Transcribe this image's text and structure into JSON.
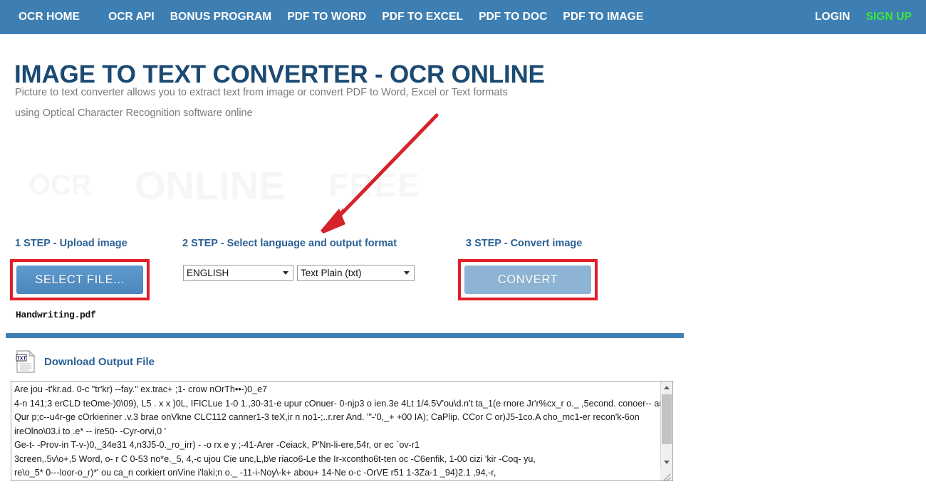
{
  "navbar": {
    "left_items": [
      {
        "label": "OCR HOME",
        "name": "nav-ocr-home"
      },
      {
        "label": "OCR API",
        "name": "nav-ocr-api"
      },
      {
        "label": "BONUS PROGRAM",
        "name": "nav-bonus-program"
      },
      {
        "label": "PDF TO WORD",
        "name": "nav-pdf-to-word"
      },
      {
        "label": "PDF TO EXCEL",
        "name": "nav-pdf-to-excel"
      },
      {
        "label": "PDF TO DOC",
        "name": "nav-pdf-to-doc"
      },
      {
        "label": "PDF TO IMAGE",
        "name": "nav-pdf-to-image"
      }
    ],
    "login_label": "LOGIN",
    "signup_label": "SIGN UP",
    "background_color": "#3e7fb3",
    "link_color": "#ffffff",
    "signup_color": "#3ce63c"
  },
  "hero": {
    "title": "IMAGE TO TEXT CONVERTER - OCR ONLINE",
    "title_color": "#1b4a73",
    "subtitle_line1": "Picture to text converter allows you to extract text from image or convert PDF to Word, Excel or Text formats",
    "subtitle_line2": "using Optical Character Recognition software online"
  },
  "watermark": {
    "part1": "OCR",
    "part2": "ONLINE",
    "part3": "FREE"
  },
  "annotation": {
    "arrow_color": "#d6232b",
    "arrow_name": "red-pointer-arrow"
  },
  "steps": {
    "step1_label": "1 STEP - Upload image",
    "step2_label": "2 STEP - Select language and output format",
    "step3_label": "3 STEP - Convert image",
    "label_color": "#2a6196"
  },
  "controls": {
    "select_file_label": "SELECT FILE...",
    "convert_label": "CONVERT",
    "highlight_color": "#e21f26",
    "select_file_color": "#4a86bd",
    "convert_color": "#8db4d4",
    "language_selected": "ENGLISH",
    "language_options": [
      "ENGLISH"
    ],
    "format_selected": "Text Plain (txt)",
    "format_options": [
      "Text Plain (txt)"
    ],
    "uploaded_filename": "Handwriting.pdf"
  },
  "download": {
    "icon_label": "TXT",
    "link_label": "Download Output File",
    "link_color": "#2a6196"
  },
  "output": {
    "lines": [
      "Are jou -t'kr.ad. 0-c \"tr'kr) --fay.\" ex.trac+ ;1- crow nOrTh••-)0_e7",
      "4-n 141;3 erCLD teOme-)0\\09), L5 . x x )0L, IFICLue 1-0 1.,30-31-e upur cOnuer- 0-njp3 o ien.3e 4Lt 1/4.5V'ou\\d.n't ta_1(e rnore Jr'r%cx_r o._ ,5econd. conoer-- an",
      "Qur p;c--u4r-ge cOrkieriner .v.3 brae onVkne CLC112 canner1-3 teX,ir n no1-;..r.rer And. \"'-'0,_+ +00 IA); CaPlip. CCor C or)J5-1co.A cho_mc1-er recon'k-6on",
      "ireOlno\\03.i to .e* -- ire50- -Cyr-orvi,0 '",
      "Ge-t- -Prov-in T-v-)0,_34e31 4,n3J5-0._ro_irr) - -o rx e y ;-41-Arer -Ceiack, P'Nn-li-ere,54r, or ec `ov-r1",
      "3creen,.5v\\o+,5 Word, o- r C 0-53 no*e._5, 4,-c ujou Cie unc,L,b\\e riaco6-Le the Ir-xcontho6t-ten oc -C6enfik, 1-00 cizi 'kir -Coq- yu,",
      "re\\o_5* 0---loor-o_r)*' ou ca_n corkiert onVine i'laki;n o._ -11-i-Noy\\-k+ abou+ 14-Ne o-c -OrVE r51 1-3Za-1 _94)2.1 ,94,-r,"
    ]
  }
}
